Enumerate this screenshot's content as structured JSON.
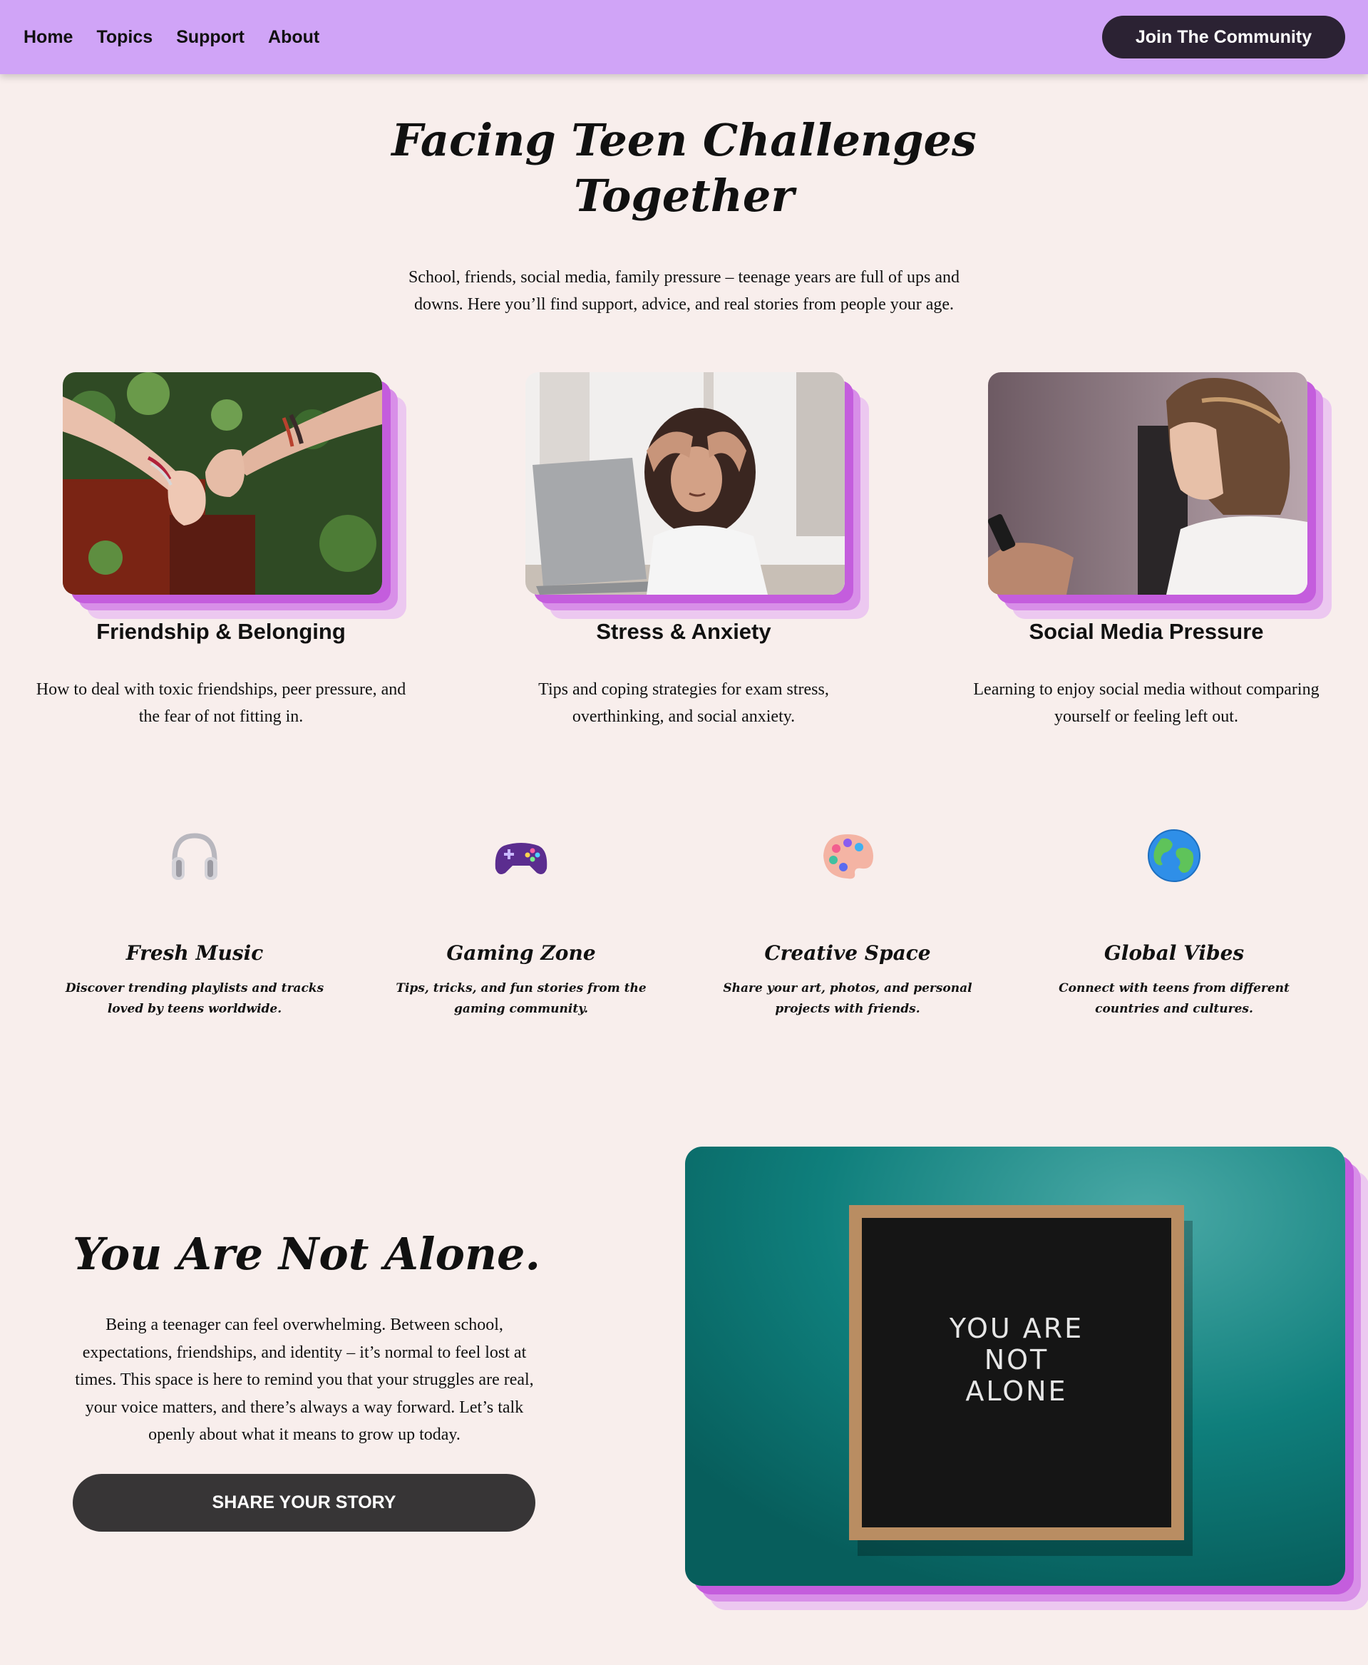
{
  "nav": {
    "items": [
      {
        "label": "Home"
      },
      {
        "label": "Topics"
      },
      {
        "label": "Support"
      },
      {
        "label": "About"
      }
    ],
    "cta_label": "Join The Community"
  },
  "hero": {
    "title_line1": "Facing Teen Challenges",
    "title_line2": "Together",
    "subtitle": "School, friends, social media, family pressure – teenage years are full of ups and downs. Here you’ll find support, advice, and real stories from people your age."
  },
  "topics": [
    {
      "title": "Friendship & Belonging",
      "description": "How to deal with toxic friendships, peer pressure, and the fear of not fitting in.",
      "image": "pinky-promise-photo"
    },
    {
      "title": "Stress & Anxiety",
      "description": "Tips and coping strategies for exam stress, overthinking, and social anxiety.",
      "image": "stressed-girl-laptop-photo"
    },
    {
      "title": "Social Media Pressure",
      "description": "Learning to enjoy social media without comparing yourself or feeling left out.",
      "image": "girl-with-phone-photo"
    }
  ],
  "features": [
    {
      "title": "Fresh Music",
      "description": "Discover trending playlists and tracks loved by teens worldwide.",
      "icon": "headphones-icon"
    },
    {
      "title": "Gaming Zone",
      "description": "Tips, tricks, and fun stories from the gaming community.",
      "icon": "game-controller-icon"
    },
    {
      "title": "Creative Space",
      "description": "Share your art, photos, and personal projects with friends.",
      "icon": "artist-palette-icon"
    },
    {
      "title": "Global Vibes",
      "description": "Connect with teens from different countries and cultures.",
      "icon": "globe-icon"
    }
  ],
  "not_alone": {
    "title": "You Are Not Alone.",
    "body": "Being a teenager can feel overwhelming. Between school, expectations, friendships, and identity – it’s normal to feel lost at times. This space is here to remind you that your struggles are real, your voice matters, and there’s always a way forward. Let’s talk openly about what it means to grow up today.",
    "button_label": "SHARE YOUR STORY",
    "board_lines": [
      "YOU ARE",
      "NOT",
      "ALONE"
    ]
  },
  "colors": {
    "header_bg": "#d0a4f7",
    "page_bg": "#f8eeec",
    "cta_bg": "#2b2233",
    "share_bg": "#373536",
    "shadow_accent": "#c45ddd"
  }
}
